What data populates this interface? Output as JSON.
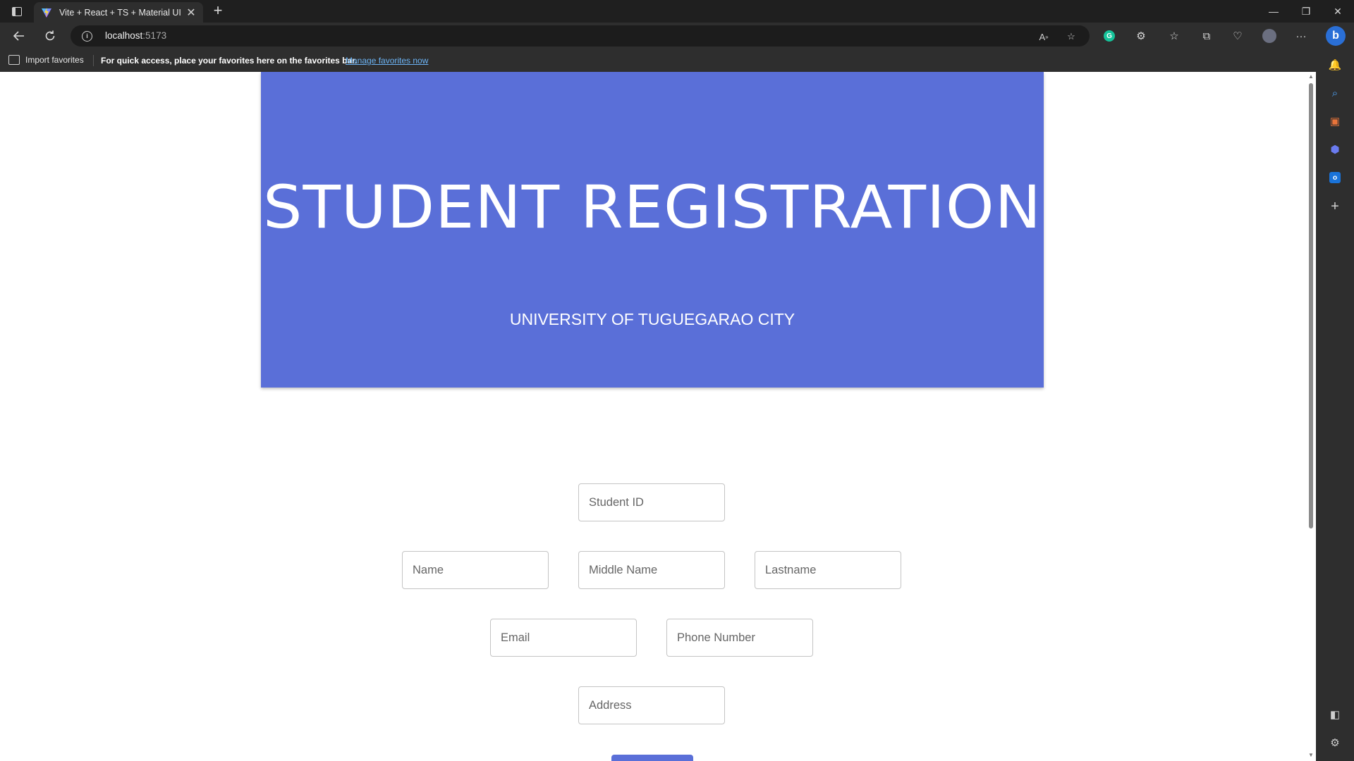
{
  "browser": {
    "tab_title": "Vite + React + TS + Material UI",
    "url_host": "localhost",
    "url_port": ":5173",
    "favorites_import": "Import favorites",
    "favorites_message": "For quick access, place your favorites here on the favorites bar.",
    "favorites_link": "Manage favorites now",
    "accent": "#2a6fd6"
  },
  "page": {
    "hero_title": "STUDENT REGISTRATION",
    "hero_subtitle": "UNIVERSITY OF TUGUEGARAO CITY",
    "hero_color": "#5a6fd8",
    "fields": {
      "student_id": "Student ID",
      "name": "Name",
      "middle_name": "Middle Name",
      "lastname": "Lastname",
      "email": "Email",
      "phone": "Phone Number",
      "address": "Address"
    }
  },
  "icons": {
    "sidebar": [
      "bell-icon",
      "search-icon",
      "toolbox-icon",
      "copilot-app-icon",
      "outlook-icon",
      "add-icon",
      "split-screen-icon",
      "settings-icon"
    ]
  }
}
